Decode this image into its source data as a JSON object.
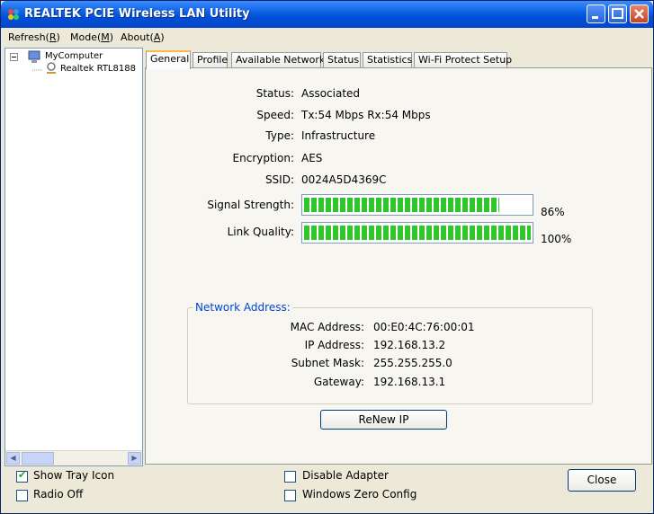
{
  "window": {
    "title": "REALTEK PCIE Wireless LAN Utility"
  },
  "menu": [
    {
      "label": "Refresh(",
      "accel": "R",
      "tail": ")"
    },
    {
      "label": "Mode(",
      "accel": "M",
      "tail": ")"
    },
    {
      "label": "About(",
      "accel": "A",
      "tail": ")"
    }
  ],
  "tree": {
    "root": "MyComputer",
    "child": "Realtek RTL8188"
  },
  "tabs": [
    "General",
    "Profile",
    "Available Network",
    "Status",
    "Statistics",
    "Wi-Fi Protect Setup"
  ],
  "general": {
    "status_label": "Status:",
    "status": "Associated",
    "speed_label": "Speed:",
    "speed": "Tx:54 Mbps Rx:54 Mbps",
    "type_label": "Type:",
    "type": "Infrastructure",
    "encryption_label": "Encryption:",
    "encryption": "AES",
    "ssid_label": "SSID:",
    "ssid": "0024A5D4369C",
    "signal_label": "Signal Strength:",
    "signal_pct": "86%",
    "signal_value": 0.86,
    "link_label": "Link Quality:",
    "link_pct": "100%",
    "link_value": 1.0
  },
  "network": {
    "title": "Network Address:",
    "mac_label": "MAC Address:",
    "mac": "00:E0:4C:76:00:01",
    "ip_label": "IP Address:",
    "ip": "192.168.13.2",
    "mask_label": "Subnet Mask:",
    "mask": "255.255.255.0",
    "gw_label": "Gateway:",
    "gw": "192.168.13.1"
  },
  "renew_label": "ReNew IP",
  "options": {
    "show_tray": {
      "label": "Show Tray Icon",
      "checked": true
    },
    "radio_off": {
      "label": "Radio Off",
      "checked": false
    },
    "disable_adapter": {
      "label": "Disable Adapter",
      "checked": false
    },
    "wzc": {
      "label": "Windows Zero Config",
      "checked": false
    }
  },
  "close_label": "Close",
  "colors": {
    "bar_fill": "#2fc629",
    "group_title": "#0046d5"
  }
}
